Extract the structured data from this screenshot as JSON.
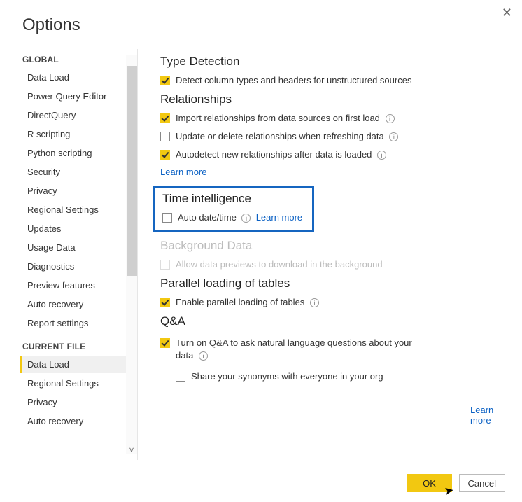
{
  "title": "Options",
  "sidebar": {
    "sections": [
      {
        "head": "GLOBAL",
        "items": [
          {
            "label": "Data Load"
          },
          {
            "label": "Power Query Editor"
          },
          {
            "label": "DirectQuery"
          },
          {
            "label": "R scripting"
          },
          {
            "label": "Python scripting"
          },
          {
            "label": "Security"
          },
          {
            "label": "Privacy"
          },
          {
            "label": "Regional Settings"
          },
          {
            "label": "Updates"
          },
          {
            "label": "Usage Data"
          },
          {
            "label": "Diagnostics"
          },
          {
            "label": "Preview features"
          },
          {
            "label": "Auto recovery"
          },
          {
            "label": "Report settings"
          }
        ]
      },
      {
        "head": "CURRENT FILE",
        "items": [
          {
            "label": "Data Load"
          },
          {
            "label": "Regional Settings"
          },
          {
            "label": "Privacy"
          },
          {
            "label": "Auto recovery"
          }
        ]
      }
    ],
    "selected": "Data Load"
  },
  "content": {
    "typeDetection": {
      "title": "Type Detection",
      "opt1": "Detect column types and headers for unstructured sources"
    },
    "relationships": {
      "title": "Relationships",
      "opt1": "Import relationships from data sources on first load",
      "opt2": "Update or delete relationships when refreshing data",
      "opt3": "Autodetect new relationships after data is loaded",
      "learn": "Learn more"
    },
    "timeIntel": {
      "title": "Time intelligence",
      "opt1": "Auto date/time",
      "learn": "Learn more"
    },
    "background": {
      "title": "Background Data",
      "opt1": "Allow data previews to download in the background"
    },
    "parallel": {
      "title": "Parallel loading of tables",
      "opt1": "Enable parallel loading of tables"
    },
    "qna": {
      "title": "Q&A",
      "opt1": "Turn on Q&A to ask natural language questions about your data",
      "opt2": "Share your synonyms with everyone in your org",
      "learn": "Learn more"
    }
  },
  "buttons": {
    "ok": "OK",
    "cancel": "Cancel"
  }
}
